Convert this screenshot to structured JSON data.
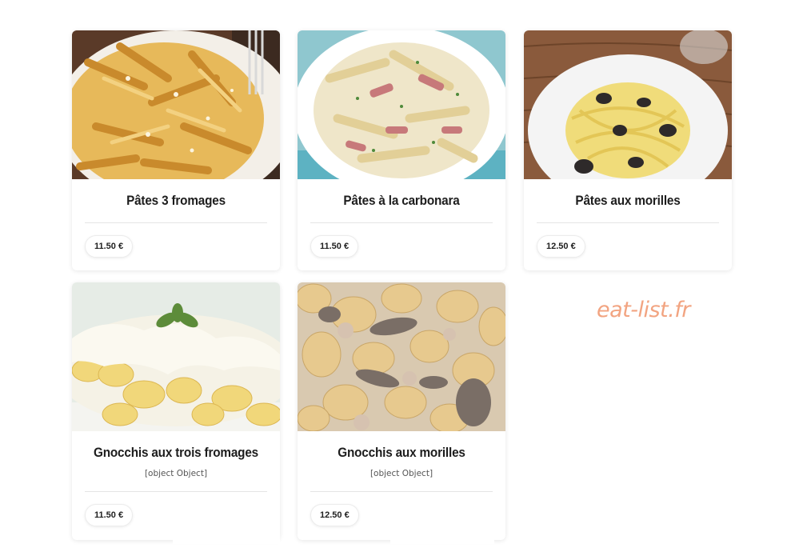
{
  "colors": {
    "watermark": "#f2a481",
    "title": "#1d1d1d",
    "price_text": "#1f1f1f"
  },
  "watermark": "eat-list.fr",
  "items": [
    {
      "title": "Pâtes 3 fromages",
      "description": "",
      "price": "11.50 €",
      "photo": "penne-cheese-photo"
    },
    {
      "title": "Pâtes à la carbonara",
      "description": "",
      "price": "11.50 €",
      "photo": "penne-carbonara-photo"
    },
    {
      "title": "Pâtes aux morilles",
      "description": "",
      "price": "12.50 €",
      "photo": "tagliatelle-morels-photo"
    },
    {
      "title": "Gnocchis aux trois fromages",
      "description": "[object Object]",
      "price": "11.50 €",
      "photo": "gnocchi-cheese-photo"
    },
    {
      "title": "Gnocchis aux morilles",
      "description": "[object Object]",
      "price": "12.50 €",
      "photo": "gnocchi-morels-photo"
    }
  ]
}
